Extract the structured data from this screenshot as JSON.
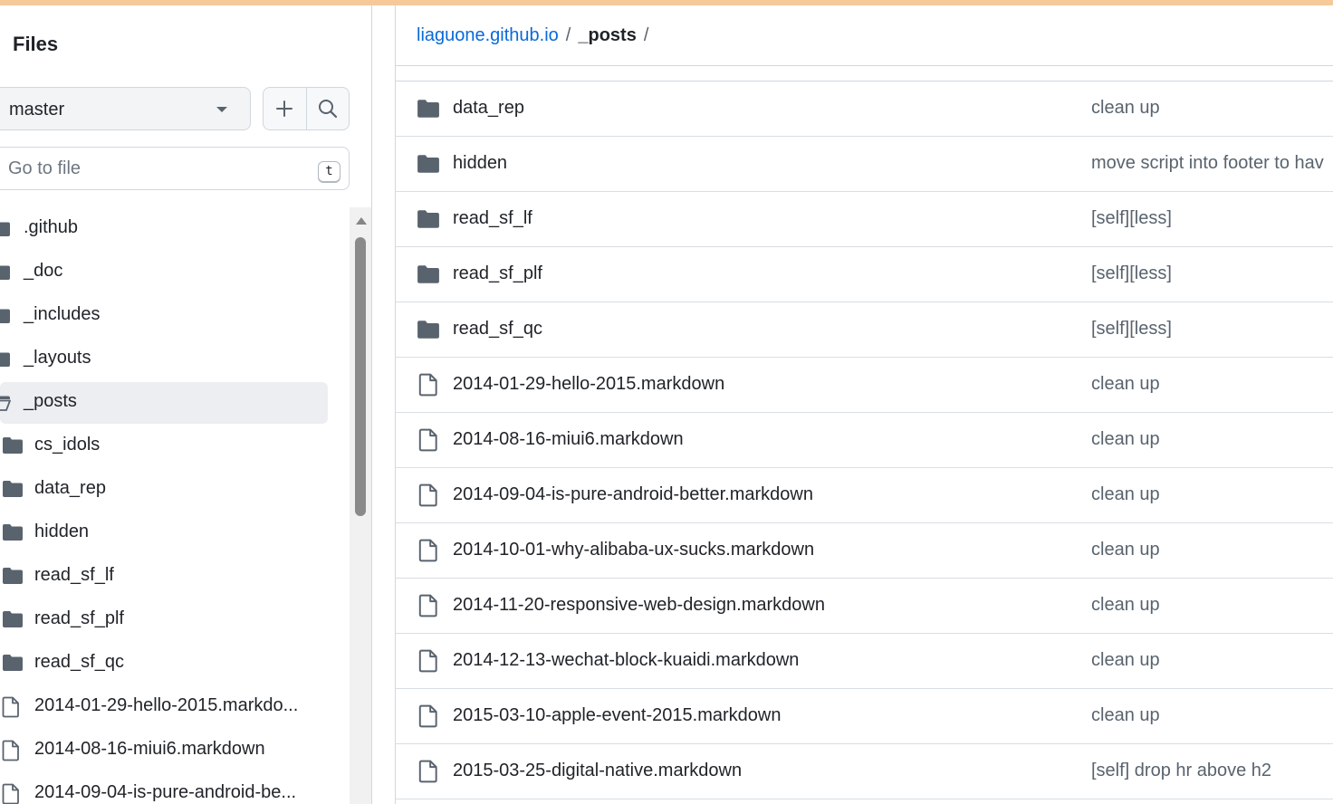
{
  "sidebar": {
    "title": "Files",
    "branch": "master",
    "goto_placeholder": "Go to file",
    "goto_shortcut": "t",
    "tree": [
      {
        "type": "folder",
        "label": ".github",
        "indent": 0,
        "selected": false
      },
      {
        "type": "folder",
        "label": "_doc",
        "indent": 0,
        "selected": false
      },
      {
        "type": "folder",
        "label": "_includes",
        "indent": 0,
        "selected": false
      },
      {
        "type": "folder",
        "label": "_layouts",
        "indent": 0,
        "selected": false
      },
      {
        "type": "folder-open",
        "label": "_posts",
        "indent": 0,
        "selected": true
      },
      {
        "type": "folder",
        "label": "cs_idols",
        "indent": 1,
        "selected": false
      },
      {
        "type": "folder",
        "label": "data_rep",
        "indent": 1,
        "selected": false
      },
      {
        "type": "folder",
        "label": "hidden",
        "indent": 1,
        "selected": false
      },
      {
        "type": "folder",
        "label": "read_sf_lf",
        "indent": 1,
        "selected": false
      },
      {
        "type": "folder",
        "label": "read_sf_plf",
        "indent": 1,
        "selected": false
      },
      {
        "type": "folder",
        "label": "read_sf_qc",
        "indent": 1,
        "selected": false
      },
      {
        "type": "file",
        "label": "2014-01-29-hello-2015.markdo...",
        "indent": 1,
        "selected": false
      },
      {
        "type": "file",
        "label": "2014-08-16-miui6.markdown",
        "indent": 1,
        "selected": false
      },
      {
        "type": "file",
        "label": "2014-09-04-is-pure-android-be...",
        "indent": 1,
        "selected": false
      }
    ]
  },
  "breadcrumb": {
    "repo": "liaguone.github.io",
    "separator": "/",
    "current": "_posts"
  },
  "rows": [
    {
      "type": "folder",
      "name": "data_rep",
      "message": "clean up"
    },
    {
      "type": "folder",
      "name": "hidden",
      "message": "move script into footer to hav"
    },
    {
      "type": "folder",
      "name": "read_sf_lf",
      "message": "[self][less]"
    },
    {
      "type": "folder",
      "name": "read_sf_plf",
      "message": "[self][less]"
    },
    {
      "type": "folder",
      "name": "read_sf_qc",
      "message": "[self][less]"
    },
    {
      "type": "file",
      "name": "2014-01-29-hello-2015.markdown",
      "message": "clean up"
    },
    {
      "type": "file",
      "name": "2014-08-16-miui6.markdown",
      "message": "clean up"
    },
    {
      "type": "file",
      "name": "2014-09-04-is-pure-android-better.markdown",
      "message": "clean up"
    },
    {
      "type": "file",
      "name": "2014-10-01-why-alibaba-ux-sucks.markdown",
      "message": "clean up"
    },
    {
      "type": "file",
      "name": "2014-11-20-responsive-web-design.markdown",
      "message": "clean up"
    },
    {
      "type": "file",
      "name": "2014-12-13-wechat-block-kuaidi.markdown",
      "message": "clean up"
    },
    {
      "type": "file",
      "name": "2015-03-10-apple-event-2015.markdown",
      "message": "clean up"
    },
    {
      "type": "file",
      "name": "2015-03-25-digital-native.markdown",
      "message": "[self] drop hr above h2"
    }
  ],
  "colors": {
    "accent_bar": "#f6c99a",
    "link": "#0969da",
    "icon": "#59636e",
    "muted_text": "#59636e"
  },
  "icons": {
    "add": "plus-icon",
    "search": "search-icon",
    "folder": "folder-icon",
    "file": "file-icon",
    "branch_caret": "chevron-down-icon"
  }
}
